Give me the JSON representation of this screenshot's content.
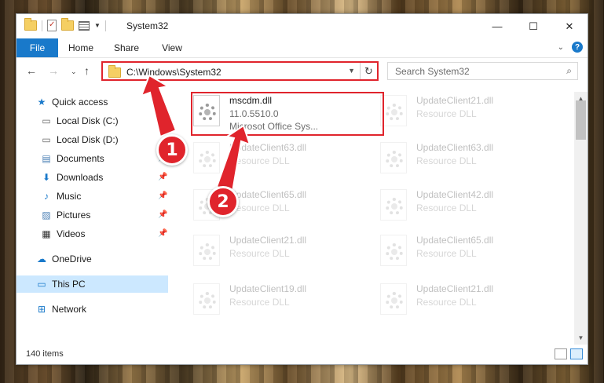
{
  "window": {
    "title": "System32",
    "controls": {
      "minimize": "—",
      "maximize": "☐",
      "close": "✕"
    }
  },
  "ribbon": {
    "tabs": [
      "File",
      "Home",
      "Share",
      "View"
    ]
  },
  "nav": {
    "address": "C:\\Windows\\System32",
    "search_placeholder": "Search System32"
  },
  "sidebar": {
    "items": [
      {
        "label": "Quick access",
        "icon": "star-icon",
        "pinned": false
      },
      {
        "label": "Local Disk (C:)",
        "icon": "drive-icon",
        "pinned": false
      },
      {
        "label": "Local Disk (D:)",
        "icon": "drive-icon",
        "pinned": false
      },
      {
        "label": "Documents",
        "icon": "documents-icon",
        "pinned": true
      },
      {
        "label": "Downloads",
        "icon": "download-icon",
        "pinned": true
      },
      {
        "label": "Music",
        "icon": "music-icon",
        "pinned": true
      },
      {
        "label": "Pictures",
        "icon": "pictures-icon",
        "pinned": true
      },
      {
        "label": "Videos",
        "icon": "videos-icon",
        "pinned": true
      },
      {
        "label": "OneDrive",
        "icon": "cloud-icon",
        "pinned": false
      },
      {
        "label": "This PC",
        "icon": "computer-icon",
        "pinned": false,
        "selected": true
      },
      {
        "label": "Network",
        "icon": "network-icon",
        "pinned": false
      }
    ]
  },
  "files": {
    "highlighted": {
      "name": "mscdm.dll",
      "version": "11.0.5510.0",
      "description": "Microsot Office Sys..."
    },
    "faded": [
      {
        "name": "UpdateClient21.dll",
        "type": "Resource DLL"
      },
      {
        "name": "UpdateClient63.dll",
        "type": "Resource DLL"
      },
      {
        "name": "UpdateClient63.dll",
        "type": "Resource DLL"
      },
      {
        "name": "UpdateClient65.dll",
        "type": "Resource DLL"
      },
      {
        "name": "UpdateClient42.dll",
        "type": "Resource DLL"
      },
      {
        "name": "UpdateClient21.dll",
        "type": "Resource DLL"
      },
      {
        "name": "UpdateClient65.dll",
        "type": "Resource DLL"
      },
      {
        "name": "UpdateClient19.dll",
        "type": "Resource DLL"
      },
      {
        "name": "UpdateClient21.dll",
        "type": "Resource DLL"
      }
    ]
  },
  "status": {
    "count": "140 items"
  },
  "annotations": {
    "step1": "1",
    "step2": "2",
    "color": "#e0242c"
  }
}
